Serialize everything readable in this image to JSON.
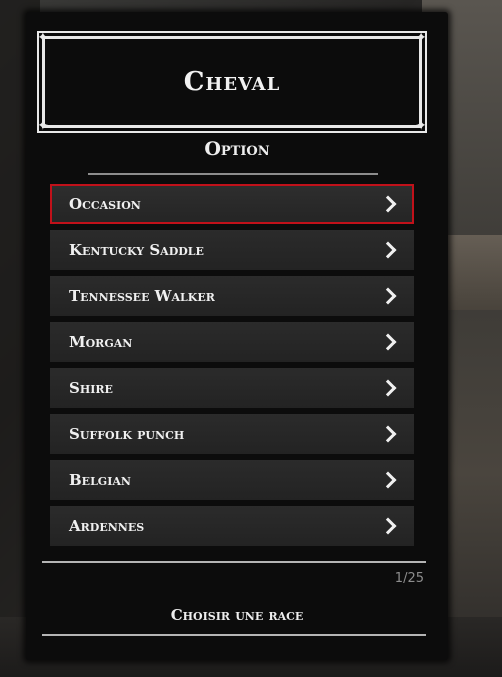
{
  "menu": {
    "title": "Cheval",
    "subtitle": "Option",
    "items": [
      {
        "label": "Occasion",
        "selected": true
      },
      {
        "label": "Kentucky Saddle",
        "selected": false
      },
      {
        "label": "Tennessee Walker",
        "selected": false
      },
      {
        "label": "Morgan",
        "selected": false
      },
      {
        "label": "Shire",
        "selected": false
      },
      {
        "label": "Suffolk punch",
        "selected": false
      },
      {
        "label": "Belgian",
        "selected": false
      },
      {
        "label": "Ardennes",
        "selected": false
      }
    ],
    "counter": "1/25",
    "footer": "Choisir une race",
    "selection_color": "#c1111a"
  }
}
